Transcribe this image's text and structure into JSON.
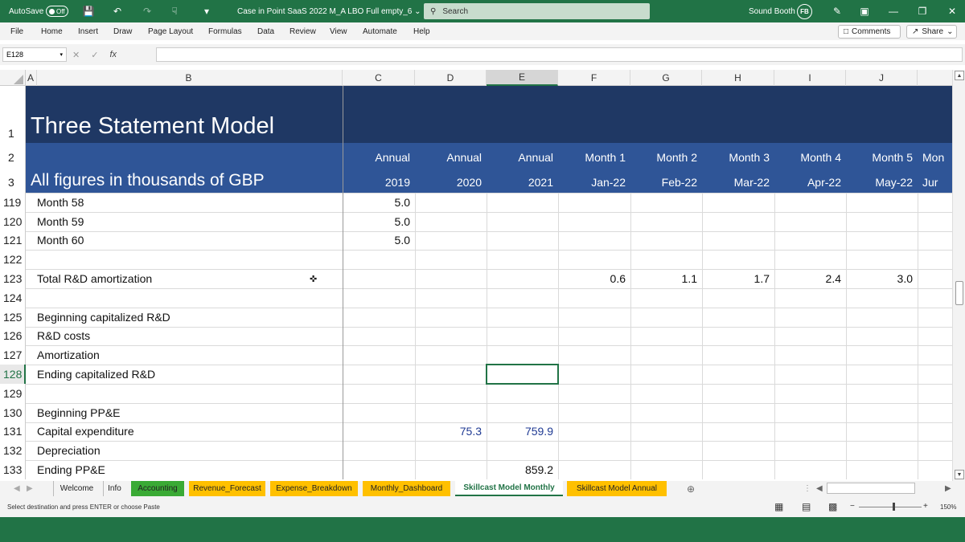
{
  "titlebar": {
    "autosave_label": "AutoSave",
    "autosave_state": "Off",
    "file_title": "Case in Point SaaS 2022 M_A LBO Full empty_6",
    "search_placeholder": "Search",
    "user_name": "Sound Booth",
    "avatar_initials": "FB",
    "accent_color": "#217346"
  },
  "menu": {
    "items": [
      "File",
      "Home",
      "Insert",
      "Draw",
      "Page Layout",
      "Formulas",
      "Data",
      "Review",
      "View",
      "Automate",
      "Help"
    ],
    "comments_label": "Comments",
    "share_label": "Share"
  },
  "formula_bar": {
    "name_box": "E128",
    "fx_label": "fx",
    "formula_value": ""
  },
  "columns": [
    "A",
    "B",
    "C",
    "D",
    "E",
    "F",
    "G",
    "H",
    "I",
    "J"
  ],
  "header": {
    "title": "Three Statement Model",
    "subtitle": "All figures in thousands of GBP",
    "row2": [
      "Annual",
      "Annual",
      "Annual",
      "Month 1",
      "Month 2",
      "Month 3",
      "Month 4",
      "Month 5",
      "Mon"
    ],
    "row3": [
      "2019",
      "2020",
      "2021",
      "Jan-22",
      "Feb-22",
      "Mar-22",
      "Apr-22",
      "May-22",
      "Jur"
    ],
    "band_dark": "#1f3864",
    "band_mid": "#2f5597"
  },
  "header_row_numbers": [
    "1",
    "2",
    "3"
  ],
  "rows": [
    {
      "num": "119",
      "label": "Month 58",
      "values": {
        "C": "5.0"
      }
    },
    {
      "num": "120",
      "label": "Month 59",
      "values": {
        "C": "5.0"
      }
    },
    {
      "num": "121",
      "label": "Month 60",
      "values": {
        "C": "5.0"
      }
    },
    {
      "num": "122",
      "label": "",
      "values": {}
    },
    {
      "num": "123",
      "label": "Total R&D amortization",
      "values": {
        "F": "0.6",
        "G": "1.1",
        "H": "1.7",
        "I": "2.4",
        "J": "3.0"
      }
    },
    {
      "num": "124",
      "label": "",
      "values": {}
    },
    {
      "num": "125",
      "label": "Beginning capitalized R&D",
      "values": {}
    },
    {
      "num": "126",
      "label": "R&D costs",
      "values": {}
    },
    {
      "num": "127",
      "label": "Amortization",
      "values": {}
    },
    {
      "num": "128",
      "label": "Ending capitalized R&D",
      "values": {}
    },
    {
      "num": "129",
      "label": "",
      "values": {}
    },
    {
      "num": "130",
      "label": "Beginning PP&E",
      "values": {}
    },
    {
      "num": "131",
      "label": "Capital expenditure",
      "values": {
        "D": "75.3",
        "E": "759.9"
      },
      "blue": true
    },
    {
      "num": "132",
      "label": "Depreciation",
      "values": {}
    },
    {
      "num": "133",
      "label": "Ending PP&E",
      "values": {
        "E": "859.2"
      }
    }
  ],
  "input_color": "#1f3a93",
  "selected_cell": "E128",
  "sheet_tabs": [
    {
      "label": "Welcome",
      "color": ""
    },
    {
      "label": "Info",
      "color": ""
    },
    {
      "label": "Accounting",
      "color": "#3aaa35"
    },
    {
      "label": "Revenue_Forecast",
      "color": "#ffc000"
    },
    {
      "label": "Expense_Breakdown",
      "color": "#ffc000"
    },
    {
      "label": "Monthly_Dashboard",
      "color": "#ffc000"
    },
    {
      "label": "Skillcast Model Monthly",
      "color": "",
      "active": true
    },
    {
      "label": "Skillcast Model Annual",
      "color": "#ffc000"
    }
  ],
  "status": {
    "message": "Select destination and press ENTER or choose Paste",
    "zoom": "150%"
  }
}
